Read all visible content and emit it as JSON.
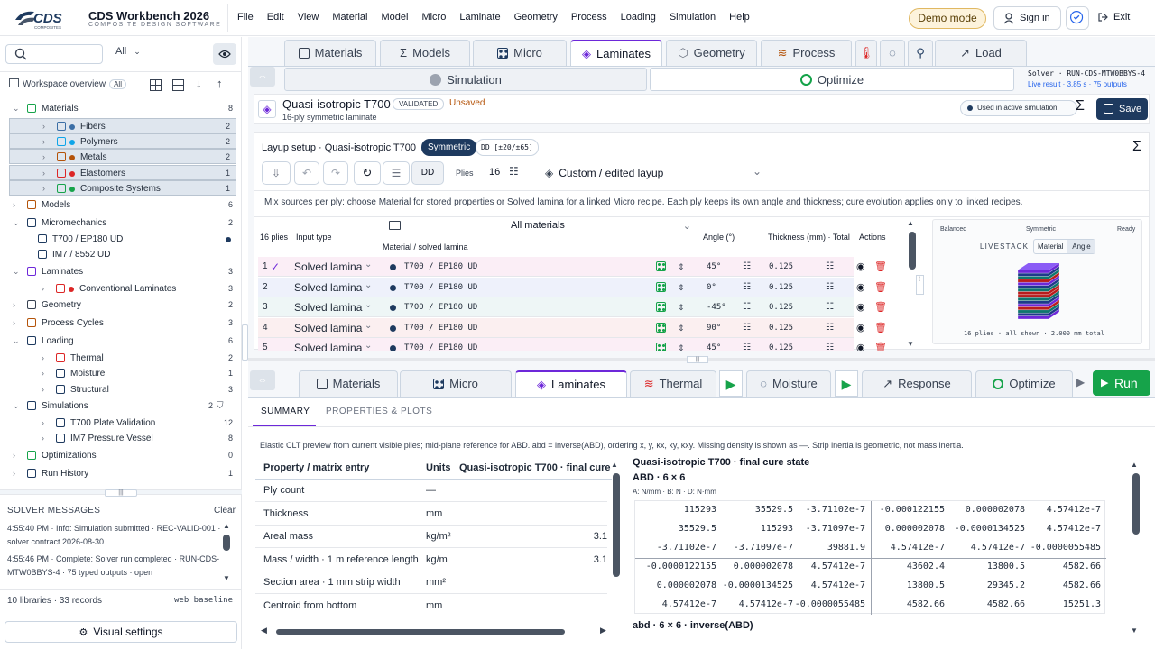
{
  "app": {
    "name": "CDS Workbench 2026",
    "subtitle": "COMPOSITE DESIGN SOFTWARE",
    "logo_text": "CDS",
    "logo_sub": "COMPOSITES"
  },
  "menu": [
    "File",
    "Edit",
    "View",
    "Material",
    "Model",
    "Micro",
    "Laminate",
    "Geometry",
    "Process",
    "Loading",
    "Simulation",
    "Help"
  ],
  "header": {
    "demo": "Demo mode",
    "signin": "Sign in",
    "exit": "Exit"
  },
  "sidebar": {
    "filter": "All",
    "workspace_label": "Workspace overview",
    "workspace_badge": "All",
    "items": [
      {
        "label": "Materials",
        "count": "8"
      },
      {
        "label": "Fibers",
        "count": "2"
      },
      {
        "label": "Polymers",
        "count": "2"
      },
      {
        "label": "Metals",
        "count": "2"
      },
      {
        "label": "Elastomers",
        "count": "1"
      },
      {
        "label": "Composite Systems",
        "count": "1"
      },
      {
        "label": "Models",
        "count": "6"
      },
      {
        "label": "Micromechanics",
        "count": "2"
      },
      {
        "label": "T700 / EP180 UD",
        "count": ""
      },
      {
        "label": "IM7 / 8552 UD",
        "count": ""
      },
      {
        "label": "Laminates",
        "count": "3"
      },
      {
        "label": "Conventional Laminates",
        "count": "3"
      },
      {
        "label": "Geometry",
        "count": "2"
      },
      {
        "label": "Process Cycles",
        "count": "3"
      },
      {
        "label": "Loading",
        "count": "6"
      },
      {
        "label": "Thermal",
        "count": "2"
      },
      {
        "label": "Moisture",
        "count": "1"
      },
      {
        "label": "Structural",
        "count": "3"
      },
      {
        "label": "Simulations",
        "count": "2"
      },
      {
        "label": "T700 Plate Validation",
        "count": "12"
      },
      {
        "label": "IM7 Pressure Vessel",
        "count": "8"
      },
      {
        "label": "Optimizations",
        "count": "0"
      },
      {
        "label": "Run History",
        "count": "1"
      }
    ],
    "solver_title": "SOLVER MESSAGES",
    "clear": "Clear",
    "messages": [
      "4:55:40 PM · Info: Simulation submitted · REC-VALID-001 · solver contract 2026-08-30",
      "4:55:46 PM · Complete: Solver run completed · RUN-CDS-MTW0BBYS-4 · 75 typed outputs · open"
    ],
    "lib_count": "10 libraries · 33 records",
    "baseline": "web baseline",
    "visual_settings": "Visual settings"
  },
  "top_tabs": [
    "Materials",
    "Models",
    "Micro",
    "Laminates",
    "Geometry",
    "Process",
    "Load"
  ],
  "sub_tabs": {
    "simulation": "Simulation",
    "optimize": "Optimize"
  },
  "solver_status": {
    "run": "Solver · RUN-CDS-MTW0BBYS-4",
    "live": "Live result · 3.85 s · 75 outputs"
  },
  "laminate": {
    "title": "Quasi-isotropic T700",
    "validated": "VALIDATED",
    "unsaved": "Unsaved",
    "subtitle": "16-ply symmetric laminate",
    "used_in_sim": "Used in active simulation",
    "save": "Save",
    "layup_title": "Layup setup · Quasi-isotropic T700",
    "symmetric": "Symmetric",
    "dd": "DD [±20/±65]",
    "dd_btn": "DD",
    "plies_label": "Plies",
    "plies_value": "16",
    "layup_select": "Custom / edited layup",
    "info": "Mix sources per ply: choose Material for stored properties or Solved lamina for a linked Micro recipe. Each ply keeps its own angle and thickness; cure evolution applies only to linked recipes.",
    "col_plies": "16 plies",
    "col_input": "Input type",
    "col_material": "Material / solved lamina",
    "all_materials": "All materials",
    "col_angle": "Angle (°)",
    "col_thk": "Thickness (mm) · Total",
    "col_actions": "Actions",
    "rows": [
      {
        "n": "1",
        "input": "Solved lamina",
        "mat": "T700 / EP180 UD",
        "angle": "45°",
        "thk": "0.125"
      },
      {
        "n": "2",
        "input": "Solved lamina",
        "mat": "T700 / EP180 UD",
        "angle": "0°",
        "thk": "0.125"
      },
      {
        "n": "3",
        "input": "Solved lamina",
        "mat": "T700 / EP180 UD",
        "angle": "-45°",
        "thk": "0.125"
      },
      {
        "n": "4",
        "input": "Solved lamina",
        "mat": "T700 / EP180 UD",
        "angle": "90°",
        "thk": "0.125"
      },
      {
        "n": "5",
        "input": "Solved lamina",
        "mat": "T700 / EP180 UD",
        "angle": "45°",
        "thk": "0.125"
      }
    ],
    "preview": {
      "balanced": "Balanced",
      "symmetric": "Symmetric",
      "ready": "Ready",
      "livestack": "LIVESTACK",
      "material": "Material",
      "angle": "Angle",
      "footer": "16 plies · all shown · 2.000 mm total"
    }
  },
  "lower_tabs": [
    "Materials",
    "Micro",
    "Laminates",
    "Thermal",
    "Moisture",
    "Response",
    "Optimize"
  ],
  "run": "Run",
  "result_tabs": [
    "SUMMARY",
    "PROPERTIES & PLOTS"
  ],
  "result_note": "Elastic CLT preview from current visible plies; mid-plane reference for ABD. abd = inverse(ABD), ordering x, y, κx, κy, κxy. Missing density is shown as —. Strip inertia is geometric, not mass inertia.",
  "props": {
    "headers": [
      "Property / matrix entry",
      "Units",
      "Quasi-isotropic T700 · final cure"
    ],
    "rows": [
      {
        "p": "Ply count",
        "u": "—",
        "v": ""
      },
      {
        "p": "Thickness",
        "u": "mm",
        "v": ""
      },
      {
        "p": "Areal mass",
        "u": "kg/m²",
        "v": "3.1"
      },
      {
        "p": "Mass / width · 1 m reference length",
        "u": "kg/m",
        "v": "3.1"
      },
      {
        "p": "Section area · 1 mm strip width",
        "u": "mm²",
        "v": ""
      },
      {
        "p": "Centroid from bottom",
        "u": "mm",
        "v": ""
      }
    ]
  },
  "abd": {
    "title": "Quasi-isotropic T700 · final cure state",
    "subtitle": "ABD · 6 × 6",
    "units": "A: N/mm · B: N · D: N·mm",
    "rows": [
      [
        "115293",
        "35529.5",
        "-3.71102e-7",
        "-0.000122155",
        "0.000002078",
        "4.57412e-7"
      ],
      [
        "35529.5",
        "115293",
        "-3.71097e-7",
        "0.000002078",
        "-0.0000134525",
        "4.57412e-7"
      ],
      [
        "-3.71102e-7",
        "-3.71097e-7",
        "39881.9",
        "4.57412e-7",
        "4.57412e-7",
        "-0.0000055485"
      ],
      [
        "-0.0000122155",
        "0.000002078",
        "4.57412e-7",
        "43602.4",
        "13800.5",
        "4582.66"
      ],
      [
        "0.000002078",
        "-0.0000134525",
        "4.57412e-7",
        "13800.5",
        "29345.2",
        "4582.66"
      ],
      [
        "4.57412e-7",
        "4.57412e-7",
        "-0.0000055485",
        "4582.66",
        "4582.66",
        "15251.3"
      ]
    ],
    "inverse_title": "abd · 6 × 6 · inverse(ABD)"
  },
  "colors": {
    "accent": "#6d28d9",
    "brand": "#1e3a5f",
    "save": "#1e3a5f",
    "run": "#16a34a"
  }
}
